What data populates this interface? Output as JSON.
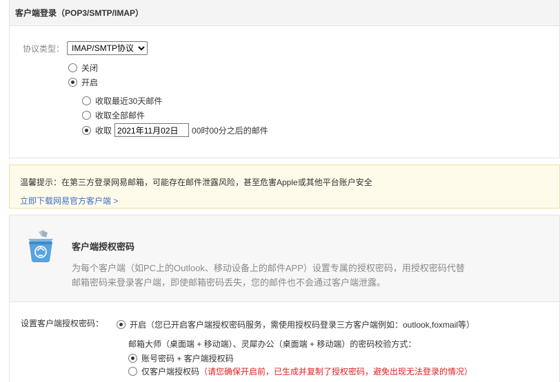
{
  "client_login": {
    "header": "客户端登录（POP3/SMTP/IMAP）",
    "protocol_label": "协议类型：",
    "protocol_selected": "IMAP/SMTP协议",
    "options": {
      "off": "关闭",
      "on": "开启"
    },
    "sub_options": {
      "last30": "收取最近30天邮件",
      "all": "收取全部邮件",
      "since_prefix": "收取",
      "since_date": "2021年11月02日",
      "since_suffix": "00时00分之后的邮件"
    }
  },
  "tip": {
    "text": "温馨提示：在第三方登录网易邮箱，可能存在邮件泄露风险，甚至危害Apple或其他平台账户安全",
    "link": "立即下载网易官方客户端 >"
  },
  "auth": {
    "title": "客户端授权密码",
    "description": "为每个客户端（如PC上的Outlook、移动设备上的邮件APP）设置专属的授权密码，用授权密码代替邮箱密码来登录客户端，即使邮箱密码丢失，您的邮件也不会通过客户端泄露。",
    "set_label": "设置客户端授权密码：",
    "on_text": "开启（您已开启客户端授权密码服务，需使用授权码登录三方客户端例如：outlook,foxmail等）",
    "verify_title": "邮箱大师（桌面端 + 移动端）、灵犀办公（桌面端 + 移动端）的密码校验方式：",
    "verify_option1": "账号密码 + 客户端授权码",
    "verify_option2": "仅客户端授权码",
    "verify_option2_warning": "（请您确保开启前，已生成并复制了授权密码，避免出现无法登录的情况）"
  },
  "colors": {
    "link": "#3d6fc3",
    "warning": "#e02020",
    "tip_bg": "#fffbea"
  }
}
